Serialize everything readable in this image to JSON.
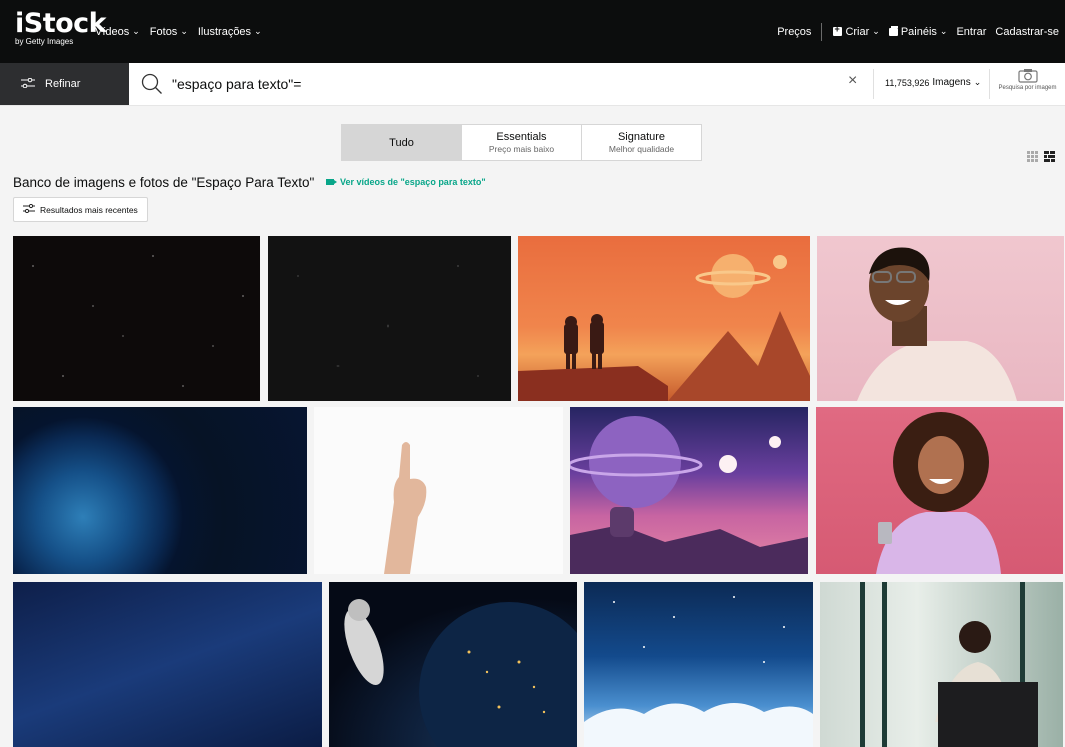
{
  "header": {
    "logo": "iStock",
    "logo_sub": "by Getty Images",
    "nav_left": [
      {
        "label": "Vídeos"
      },
      {
        "label": "Fotos"
      },
      {
        "label": "Ilustrações"
      }
    ],
    "nav_right": {
      "pricing": "Preços",
      "create": "Criar",
      "boards": "Painéis",
      "signin": "Entrar",
      "signup": "Cadastrar-se"
    }
  },
  "searchbar": {
    "refine_label": "Refinar",
    "query": "\"espaço para texto\"=",
    "count": "11,753,926",
    "count_type": "Imagens",
    "image_search": "Pesquisa por imagem"
  },
  "tabs": [
    {
      "label": "Tudo",
      "sub": ""
    },
    {
      "label": "Essentials",
      "sub": "Preço mais baixo"
    },
    {
      "label": "Signature",
      "sub": "Melhor qualidade"
    }
  ],
  "results": {
    "heading": "Banco de imagens e fotos de \"Espaço Para Texto\"",
    "video_link": "Ver vídeos de \"espaço para texto\"",
    "recent_button": "Resultados mais recentes"
  },
  "colors": {
    "accent": "#08a689",
    "header_bg": "#0c0d0d",
    "refine_bg": "#2d2e30"
  }
}
